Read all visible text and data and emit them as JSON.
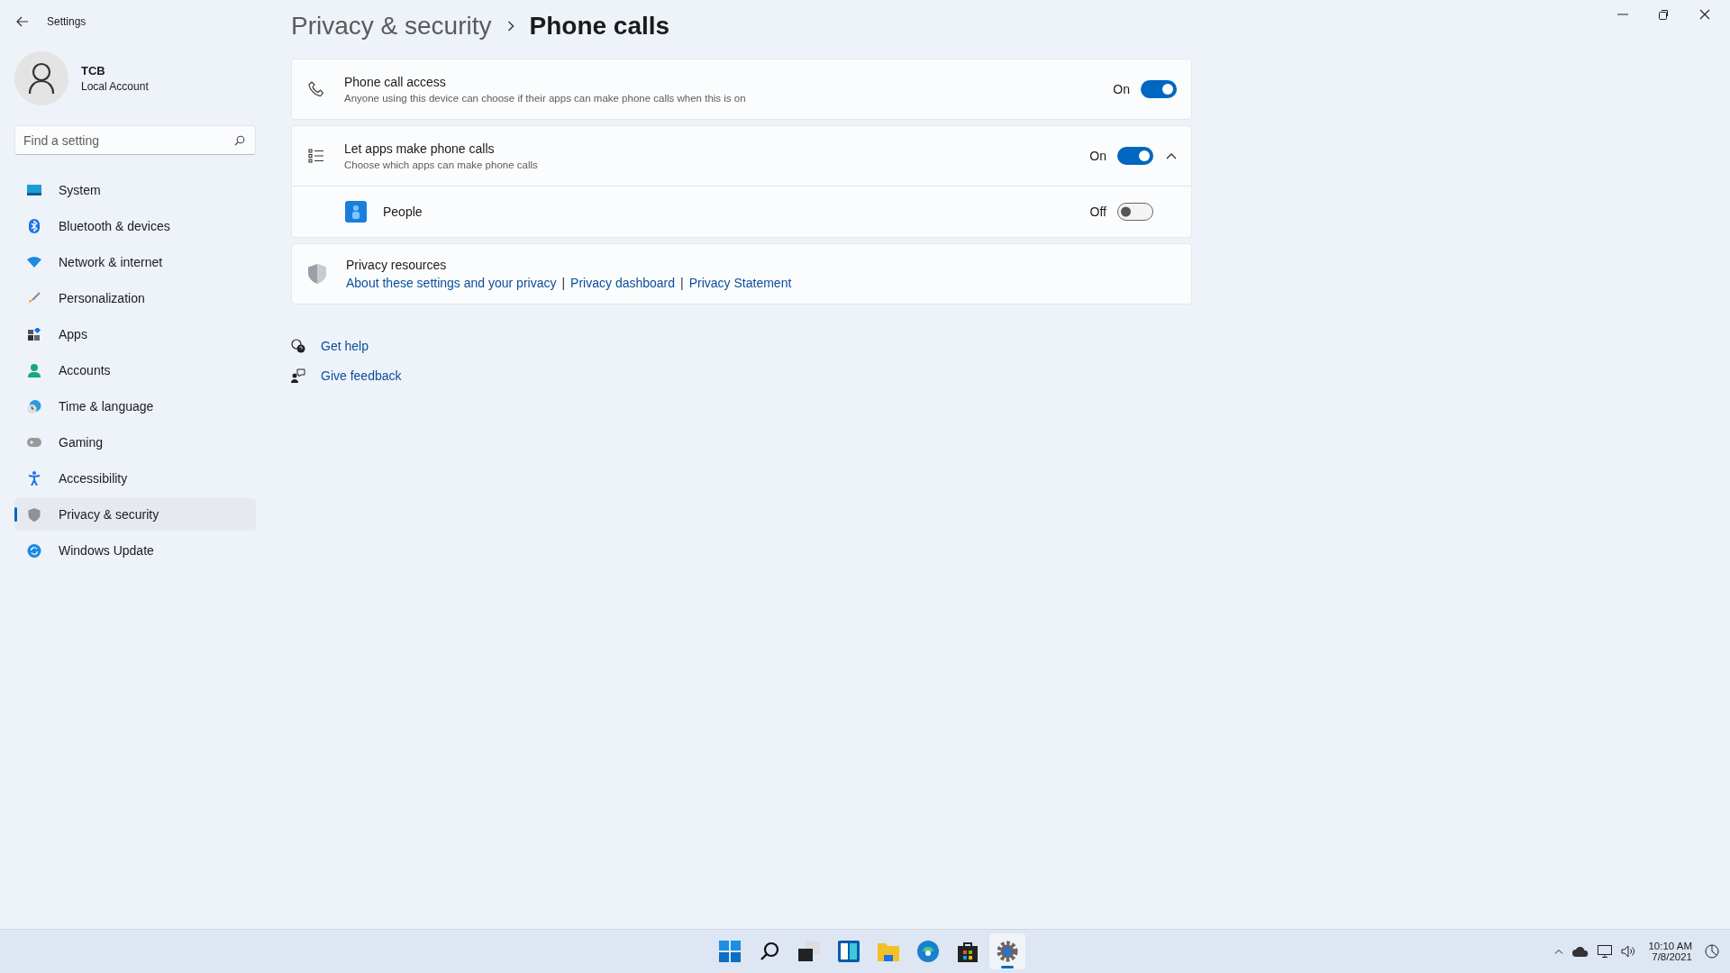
{
  "window": {
    "title": "Settings"
  },
  "user": {
    "name": "TCB",
    "account": "Local Account"
  },
  "search": {
    "placeholder": "Find a setting"
  },
  "sidebar": {
    "items": [
      {
        "label": "System",
        "kind": "system",
        "selected": false
      },
      {
        "label": "Bluetooth & devices",
        "kind": "bluetooth",
        "selected": false
      },
      {
        "label": "Network & internet",
        "kind": "network",
        "selected": false
      },
      {
        "label": "Personalization",
        "kind": "brush",
        "selected": false
      },
      {
        "label": "Apps",
        "kind": "apps",
        "selected": false
      },
      {
        "label": "Accounts",
        "kind": "accounts",
        "selected": false
      },
      {
        "label": "Time & language",
        "kind": "time",
        "selected": false
      },
      {
        "label": "Gaming",
        "kind": "gaming",
        "selected": false
      },
      {
        "label": "Accessibility",
        "kind": "accessibility",
        "selected": false
      },
      {
        "label": "Privacy & security",
        "kind": "privacy",
        "selected": true
      },
      {
        "label": "Windows Update",
        "kind": "update",
        "selected": false
      }
    ]
  },
  "breadcrumb": {
    "parent": "Privacy & security",
    "current": "Phone calls"
  },
  "settings": [
    {
      "kind": "toggle",
      "title": "Phone call access",
      "description": "Anyone using this device can choose if their apps can make phone calls when this is on",
      "state_label": "On",
      "on": true
    },
    {
      "kind": "expander",
      "title": "Let apps make phone calls",
      "description": "Choose which apps can make phone calls",
      "state_label": "On",
      "on": true,
      "expanded": true,
      "children": [
        {
          "label": "People",
          "state_label": "Off",
          "on": false
        }
      ]
    },
    {
      "kind": "links",
      "title": "Privacy resources",
      "separator": "|",
      "links": [
        "About these settings and your privacy",
        "Privacy dashboard",
        "Privacy Statement"
      ]
    }
  ],
  "help_links": [
    {
      "kind": "help",
      "label": "Get help"
    },
    {
      "kind": "feedback",
      "label": "Give feedback"
    }
  ],
  "taskbar": {
    "apps": [
      {
        "kind": "start",
        "active": false
      },
      {
        "kind": "search",
        "active": false
      },
      {
        "kind": "taskview",
        "active": false
      },
      {
        "kind": "widgets",
        "active": false
      },
      {
        "kind": "folder",
        "active": false
      },
      {
        "kind": "browser",
        "active": false
      },
      {
        "kind": "store",
        "active": false
      },
      {
        "kind": "settings",
        "active": true
      }
    ],
    "tray": {
      "time": "10:10 AM",
      "date": "7/8/2021"
    }
  }
}
